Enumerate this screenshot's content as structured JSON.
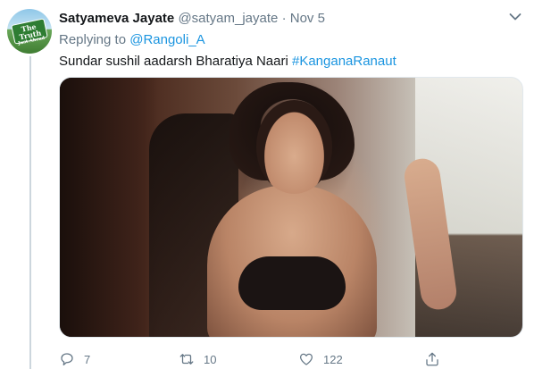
{
  "tweet": {
    "display_name": "Satyameva Jayate",
    "handle": "@satyam_jayate",
    "separator": "·",
    "date": "Nov 5",
    "replying_to_prefix": "Replying to",
    "replying_to_user": "@Rangoli_A",
    "text": "Sundar sushil aadarsh Bharatiya Naari",
    "hashtag": "#KanganaRanaut",
    "avatar": {
      "line1": "The Truth",
      "line2": "Just Ahead"
    }
  },
  "actions": {
    "replies": "7",
    "retweets": "10",
    "likes": "122"
  },
  "icons": {
    "reply": "reply-icon",
    "retweet": "retweet-icon",
    "like": "heart-icon",
    "share": "share-icon",
    "caret": "chevron-down-icon"
  },
  "colors": {
    "link": "#1b95e0",
    "secondary_text": "#657786",
    "primary_text": "#14171a"
  }
}
